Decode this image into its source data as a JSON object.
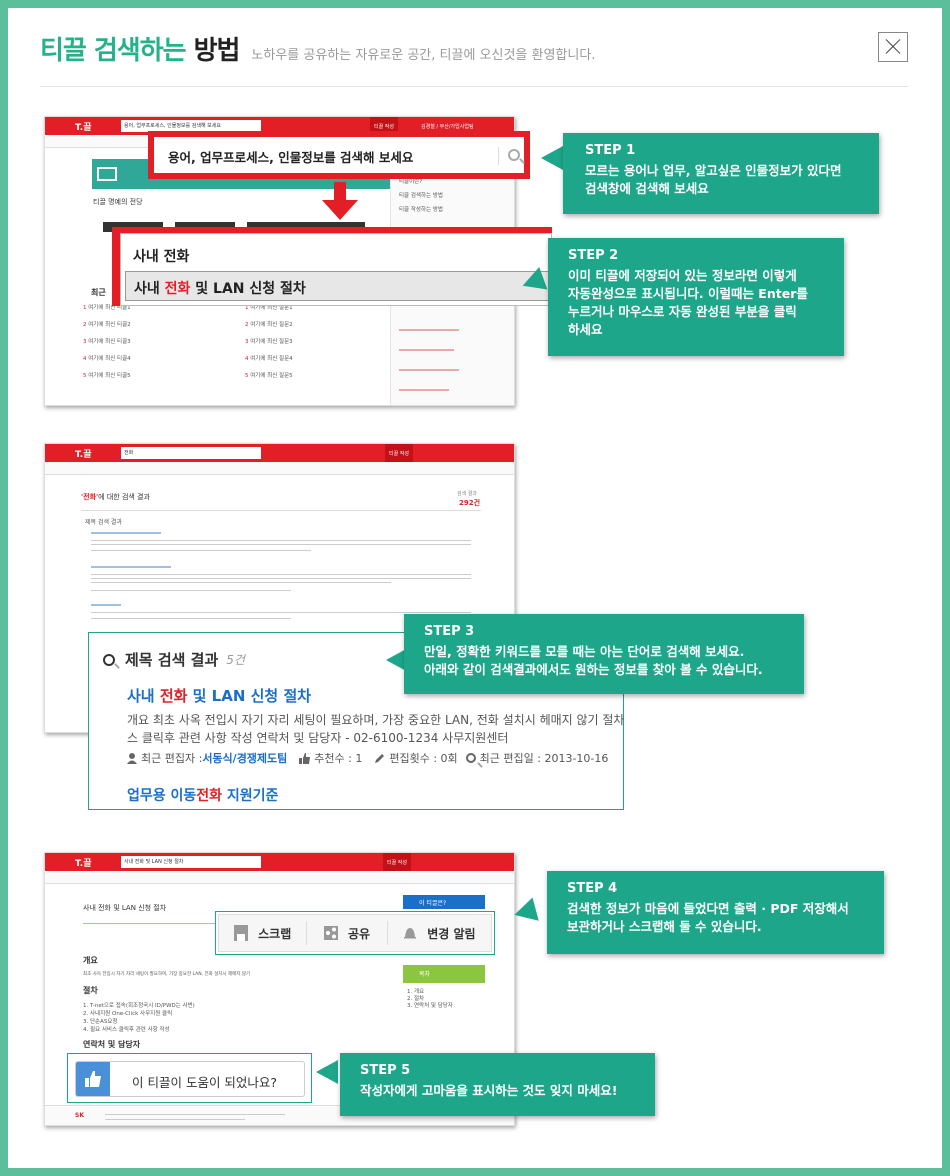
{
  "header": {
    "title_green": "티끌 검색하는",
    "title_dark": "방법",
    "subtitle": "노하우를 공유하는 자유로운 공간, 티끌에 오신것을 환영합니다."
  },
  "shot1": {
    "search_text": "용어, 업무프로세스, 인물정보를 검색해 보세요",
    "logo": "T.끌",
    "btn1": "티끌 작성",
    "btn2": "김경철 / 부산/가입사업팀",
    "hall": "티끌 명예의 전당",
    "recent": "최근",
    "ac_input": "사내 전화",
    "ac_pre": "사내 ",
    "ac_hl": "전화",
    "ac_post": " 및 LAN 신청 절차",
    "list_left": [
      "여기에 최신 티끌1",
      "여기에 최신 티끌2",
      "여기에 최신 티끌3",
      "여기에 최신 티끌4",
      "여기에 최신 티끌5"
    ],
    "list_right": [
      "여기에 최신 질문1",
      "여기에 최신 질문2",
      "여기에 최신 질문3",
      "여기에 최신 질문4",
      "여기에 최신 질문5"
    ],
    "side_items": [
      "티끌이란?",
      "티끌 검색하는 방법",
      "티끌 작성하는 방법"
    ]
  },
  "shot2": {
    "search_value": "전화",
    "result_title_hl": "'전화'",
    "result_title_rest": "에 대한 검색 결과",
    "count_label": "검색 결과",
    "count": "292건",
    "zoom_heading": "제목 검색 결과",
    "zoom_count": "5건",
    "r1_pre": "사내 ",
    "r1_hl": "전화",
    "r1_post": " 및 LAN 신청 절차",
    "r1_desc": "개요  최초 사옥 전입시 자기 자리 세팅이 필요하며, 가장 중요한 LAN, 전화 설치시 헤매지 않기   절차",
    "r1_desc2": "스 클릭후 관련 사항 작성   연락처 및 담당자 - 02-6100-1234 사무지원센터",
    "meta_editor_label": "최근 편집자 : ",
    "meta_editor": "서동식/경쟁제도팀",
    "meta_rec": "추천수 : 1",
    "meta_edits": "편집횟수 : 0회",
    "meta_date": "최근 편집일 : 2013-10-16",
    "r2_pre": "업무용 이동",
    "r2_hl": "전화",
    "r2_post": " 지원기준"
  },
  "shot3": {
    "search_value": "사내 전화 및 LAN 신청 절차",
    "doc_title": "사내 전화 및 LAN 신청 절차",
    "scrap": "스크랩",
    "share": "공유",
    "alert": "변경 알림",
    "section_overview": "개요",
    "overview_text": "최초 사옥 전입시 자기 자리 세팅이 필요하며, 가장 중요한 LAN, 전화 설치시 헤매지 않기",
    "section_proc": "절차",
    "proc": [
      "1. T-net으로 접속(회조청국시 ID/PWD는 사번)",
      "2. 사내지원 One-Click 사무지원 클릭",
      "3. 단순AS요청",
      "4. 필요 서비스 클릭후 관련 사항 작성"
    ],
    "section_contact": "연락처 및 담당자",
    "helpful": "이 티끌이 도움이 되었나요?",
    "side_title": "이 티끌은?",
    "toc_title": "목차",
    "toc": [
      "1.  개요",
      "2.  절차",
      "3.  연락처 및 담당자"
    ]
  },
  "steps": [
    {
      "title": "STEP 1",
      "desc": [
        "모르는 용어나 업무, 알고싶은 인물정보가 있다면",
        "검색창에 검색해 보세요"
      ]
    },
    {
      "title": "STEP 2",
      "desc": [
        "이미 티끌에 저장되어 있는 정보라면 이렇게",
        "자동완성으로 표시됩니다. 이럴때는 Enter를",
        "누르거나 마우스로 자동 완성된 부분을 클릭",
        "하세요"
      ]
    },
    {
      "title": "STEP 3",
      "desc": [
        "만일, 정확한 키워드를 모를 때는 아는 단어로 검색해 보세요.",
        "아래와 같이 검색결과에서도 원하는 정보를 찾아 볼 수 있습니다."
      ]
    },
    {
      "title": "STEP 4",
      "desc": [
        "검색한 정보가 마음에 들었다면 출력 · PDF 저장해서",
        "보관하거나 스크랩해 둘 수 있습니다."
      ]
    },
    {
      "title": "STEP 5",
      "desc": [
        "작성자에게 고마움을 표시하는 것도 잊지 마세요!"
      ]
    }
  ],
  "colors": {
    "accent": "#1da68a",
    "brand_red": "#e21e27",
    "link_blue": "#1a6fc9"
  }
}
